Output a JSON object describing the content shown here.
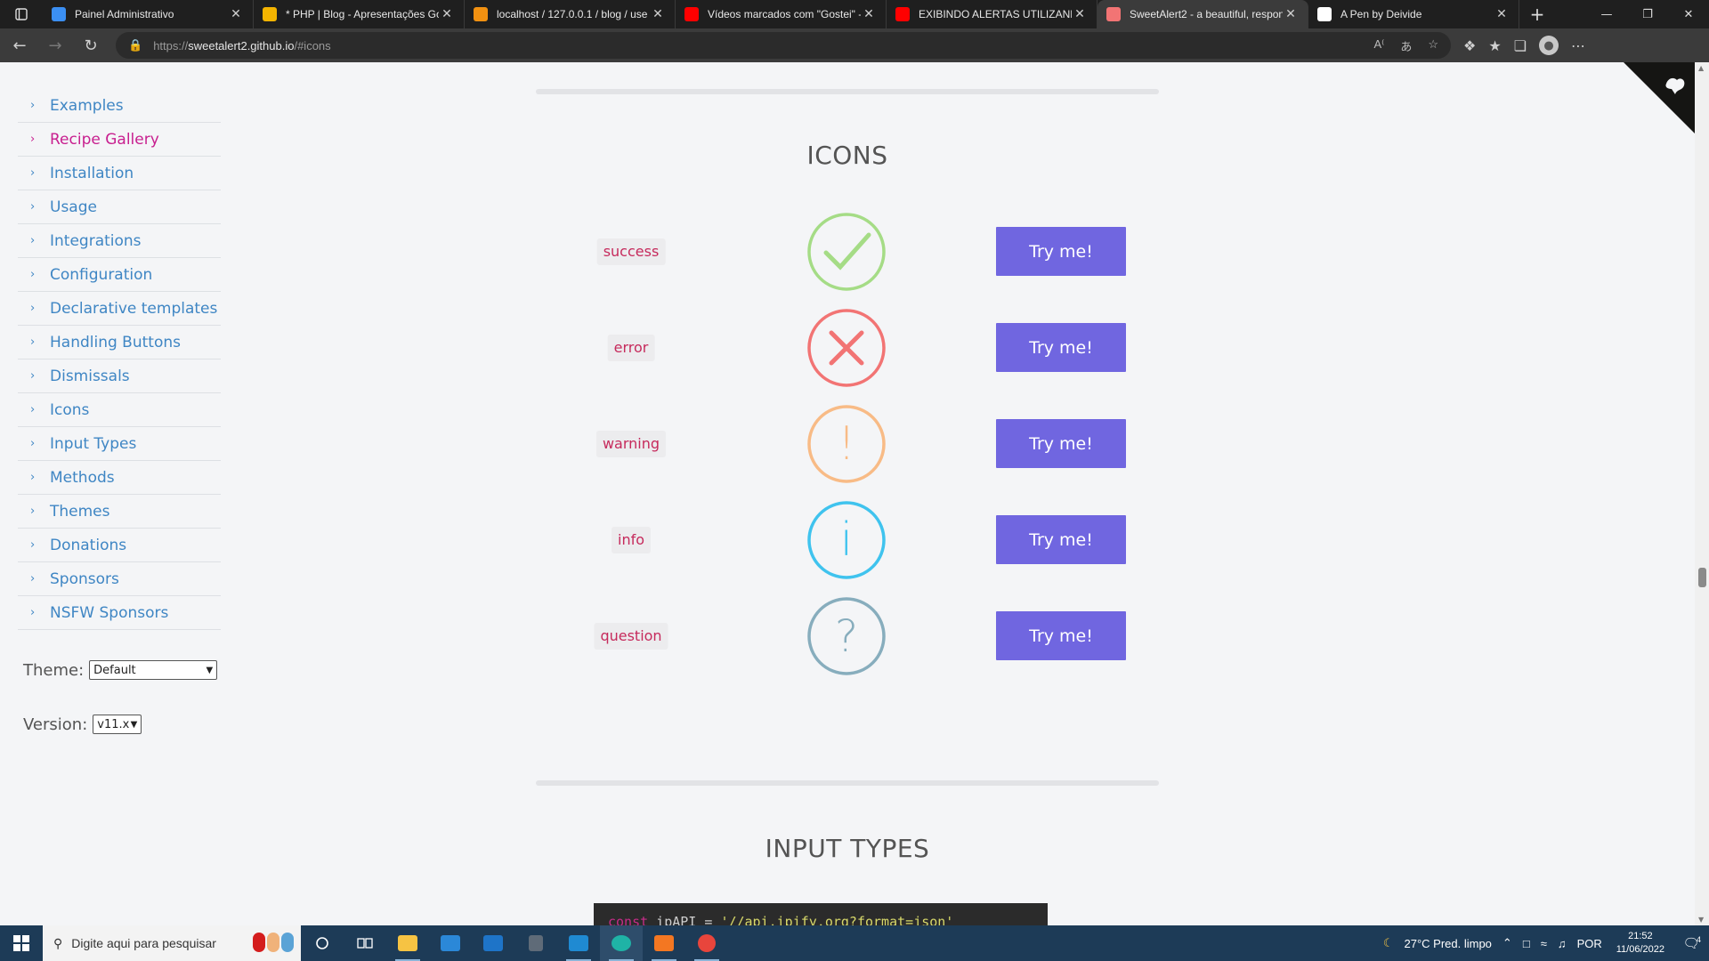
{
  "browser": {
    "tabs": [
      {
        "title": "Painel Administrativo",
        "favicon_color": "#3b8ff3",
        "active": false
      },
      {
        "title": "* PHP | Blog - Apresentações Go",
        "favicon_color": "#f4b400",
        "active": false
      },
      {
        "title": "localhost / 127.0.0.1 / blog / use",
        "favicon_color": "#f29111",
        "active": false
      },
      {
        "title": "Vídeos marcados com \"Gostei\" -",
        "favicon_color": "#ff0000",
        "active": false
      },
      {
        "title": "EXIBINDO ALERTAS UTILIZANDO",
        "favicon_color": "#ff0000",
        "active": false
      },
      {
        "title": "SweetAlert2 - a beautiful, respon",
        "favicon_color": "#f27474",
        "active": true
      },
      {
        "title": "A Pen by Deivide",
        "favicon_color": "#ffffff",
        "active": false
      }
    ],
    "address": {
      "scheme": "https://",
      "host": "sweetalert2.github.io",
      "path": "/#icons"
    }
  },
  "sidebar": {
    "items": [
      {
        "label": "Examples",
        "highlight": false
      },
      {
        "label": "Recipe Gallery",
        "highlight": true
      },
      {
        "label": "Installation",
        "highlight": false
      },
      {
        "label": "Usage",
        "highlight": false
      },
      {
        "label": "Integrations",
        "highlight": false
      },
      {
        "label": "Configuration",
        "highlight": false
      },
      {
        "label": "Declarative templates",
        "highlight": false
      },
      {
        "label": "Handling Buttons",
        "highlight": false
      },
      {
        "label": "Dismissals",
        "highlight": false
      },
      {
        "label": "Icons",
        "highlight": false
      },
      {
        "label": "Input Types",
        "highlight": false
      },
      {
        "label": "Methods",
        "highlight": false
      },
      {
        "label": "Themes",
        "highlight": false
      },
      {
        "label": "Donations",
        "highlight": false
      },
      {
        "label": "Sponsors",
        "highlight": false
      },
      {
        "label": "NSFW Sponsors",
        "highlight": false
      }
    ],
    "theme_label": "Theme:",
    "theme_value": "Default",
    "version_label": "Version:",
    "version_value": "v11.x"
  },
  "main": {
    "icons_title": "ICONS",
    "icons": [
      {
        "name": "success",
        "color": "#a5dc86",
        "symbol": "check",
        "button": "Try me!"
      },
      {
        "name": "error",
        "color": "#f27474",
        "symbol": "cross",
        "button": "Try me!"
      },
      {
        "name": "warning",
        "color": "#f8bb86",
        "symbol": "!",
        "button": "Try me!"
      },
      {
        "name": "info",
        "color": "#3fc3ee",
        "symbol": "i",
        "button": "Try me!"
      },
      {
        "name": "question",
        "color": "#87adbd",
        "symbol": "?",
        "button": "Try me!"
      }
    ],
    "input_types_title": "INPUT TYPES",
    "code_keyword": "const",
    "code_var": " ipAPI = ",
    "code_string": "'//api.ipify.org?format=json'",
    "accent_button": "#7066e0",
    "code_label_color": "#c62a5c"
  },
  "taskbar": {
    "search_placeholder": "Digite aqui para pesquisar",
    "weather": "27°C  Pred. limpo",
    "language": "POR",
    "time": "21:52",
    "date": "11/06/2022",
    "notification_count": "4"
  }
}
